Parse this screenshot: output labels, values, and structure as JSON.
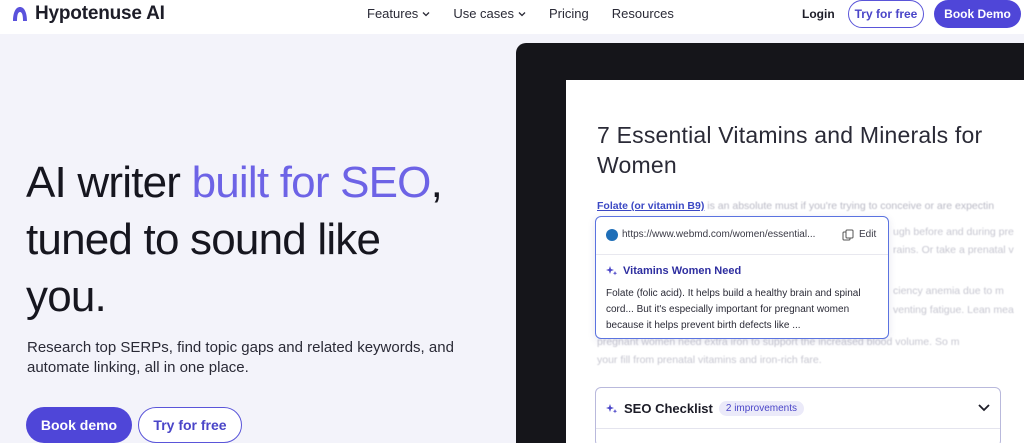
{
  "colors": {
    "brand": "#4f46d8",
    "accent_text": "#6d63e6",
    "link": "#3b48c4"
  },
  "nav": {
    "brand_name": "Hypotenuse AI",
    "links": [
      {
        "label": "Features",
        "icon": "chevron-down-icon"
      },
      {
        "label": "Use cases",
        "icon": "chevron-down-icon"
      },
      {
        "label": "Pricing"
      },
      {
        "label": "Resources"
      }
    ],
    "login_label": "Login",
    "try_label": "Try for free",
    "demo_label": "Book Demo"
  },
  "hero": {
    "title_part1": "AI writer ",
    "title_accent": "built for SEO",
    "title_part2": ",",
    "title_line2": "tuned to sound like",
    "title_line3": "you.",
    "subtitle": "Research top SERPs, find topic gaps and related keywords, and automate linking, all in one place.",
    "book_label": "Book demo",
    "try_label": "Try for free"
  },
  "editor": {
    "doc_title": "7 Essential Vitamins and Minerals for Women",
    "para_link": "Folate (or vitamin B9)",
    "para_text": " is an absolute must if you're trying to conceive or are expectin",
    "para_line2": "ugh before and during pre",
    "para_line3": "rains. Or take a prenatal v",
    "para_line4": "ciency anemia due to m",
    "para_line5": "venting fatigue. Lean mea",
    "para_line6": "pregnant women need extra iron to support the increased blood volume. So m",
    "para_line7": "your fill from prenatal vitamins and iron-rich fare.",
    "popup": {
      "url": "https://www.webmd.com/women/essential...",
      "edit_label": "Edit",
      "heading": "Vitamins Women Need",
      "body": "Folate (folic acid). It helps build a healthy brain and spinal cord... But it's especially important for pregnant women because it helps prevent birth defects like ..."
    },
    "seo": {
      "title": "SEO Checklist",
      "badge": "2 improvements"
    }
  }
}
